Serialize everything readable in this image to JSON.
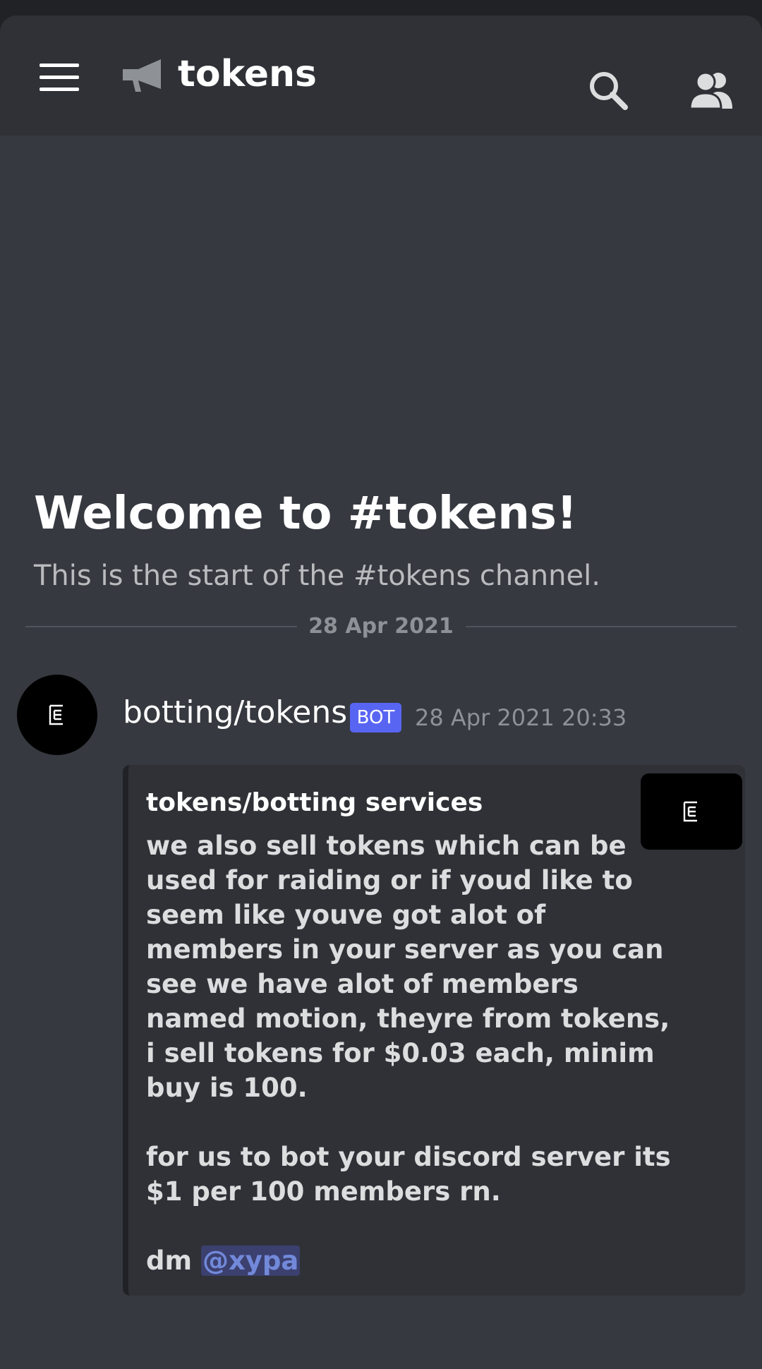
{
  "header": {
    "channel_name": "tokens"
  },
  "welcome": {
    "title": "Welcome to #tokens!",
    "subtitle": "This is the start of the #tokens channel."
  },
  "date_divider": "28 Apr 2021",
  "message": {
    "author": "botting/tokens",
    "bot_tag": "BOT",
    "timestamp": "28 Apr 2021 20:33",
    "embed": {
      "title": "tokens/botting services",
      "lines": [
        "we also sell tokens which can be",
        "used for raiding or if youd like to",
        "seem like youve got alot of",
        "members in your server as you can",
        "see we have alot of members",
        "named motion, theyre from tokens,",
        "i sell tokens for $0.03 each, minim",
        "buy is 100.",
        "",
        "for us to bot your discord server its",
        "$1 per 100 members rn.",
        ""
      ],
      "dm_prefix": "dm",
      "mention": "@xypa"
    }
  },
  "colors": {
    "background": "#36393f",
    "header_bg": "#2f3136",
    "embed_bg": "#2f3136",
    "bot_tag": "#5865f2",
    "mention": "#7289da"
  },
  "icons": {
    "menu": "hamburger-icon",
    "channel": "announcement-megaphone-icon",
    "search": "search-icon",
    "members": "members-icon",
    "avatar": "bracket-logo-icon"
  }
}
